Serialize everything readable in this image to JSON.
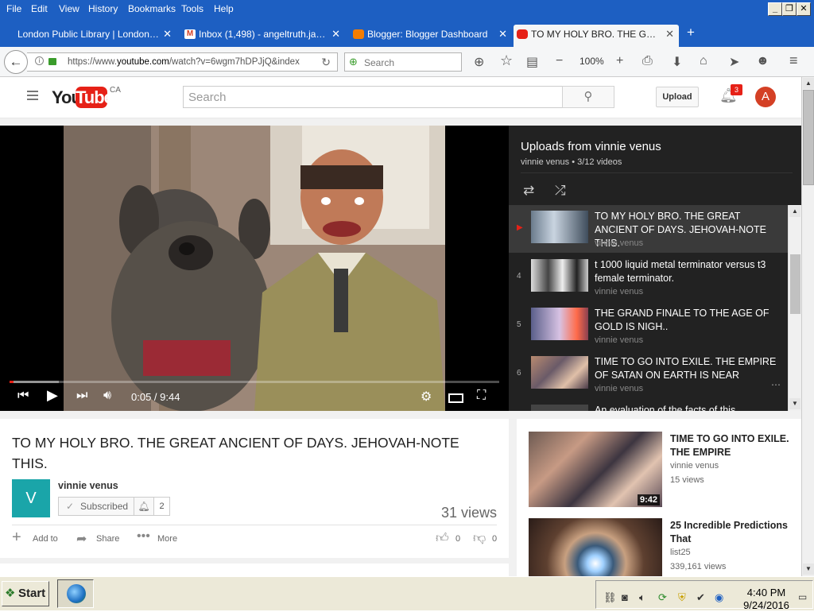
{
  "menubar": {
    "items": [
      "File",
      "Edit",
      "View",
      "History",
      "Bookmarks",
      "Tools",
      "Help"
    ],
    "minimize": "_",
    "restore": "❐",
    "close": "✕"
  },
  "tabs": [
    {
      "title": "London Public Library | London Pu…",
      "close": "✕"
    },
    {
      "title": "Inbox (1,498) - angeltruth.ja…",
      "close": "✕"
    },
    {
      "title": "Blogger: Blogger Dashboard",
      "close": "✕"
    },
    {
      "title": "TO MY HOLY BRO. THE GREAT…",
      "close": "✕"
    }
  ],
  "new_tab": "+",
  "navbar": {
    "url_prefix": "https://www.",
    "url_domain": "youtube.com",
    "url_rest": "/watch?v=6wgm7hDPJjQ&index",
    "search_placeholder": "Search",
    "zoom": "100%",
    "zoom_minus": "−",
    "zoom_plus": "+"
  },
  "youtube": {
    "logo_you": "You",
    "logo_tube": "Tube",
    "logo_region": "CA",
    "search_placeholder": "Search",
    "upload_label": "Upload",
    "notification_count": "3",
    "avatar_letter": "A"
  },
  "player": {
    "time": "0:05 / 9:44",
    "progress_fraction": 0.0086
  },
  "playlist": {
    "title": "Uploads from vinnie venus",
    "subtitle": "vinnie venus • 3/12 videos",
    "current_marker": "▶",
    "items": [
      {
        "index": "",
        "title": "TO MY HOLY BRO. THE GREAT ANCIENT OF DAYS. JEHOVAH-NOTE THIS.",
        "author": "vinnie venus"
      },
      {
        "index": "4",
        "title": "t 1000 liquid metal terminator versus t3 female terminator.",
        "author": "vinnie venus"
      },
      {
        "index": "5",
        "title": "THE GRAND FINALE TO THE AGE OF GOLD IS NIGH..",
        "author": "vinnie venus"
      },
      {
        "index": "6",
        "title": "TIME TO GO INTO EXILE. THE EMPIRE OF SATAN ON EARTH IS NEAR",
        "author": "vinnie venus"
      },
      {
        "index": "",
        "title": "An evaluation of the facts of this",
        "author": ""
      }
    ],
    "more": "⋯"
  },
  "video_info": {
    "title": "TO MY HOLY BRO. THE GREAT ANCIENT OF DAYS. JEHOVAH-NOTE THIS.",
    "channel_initial": "V",
    "channel_name": "vinnie venus",
    "subscribed_label": "Subscribed",
    "subscriber_count": "2",
    "views": "31 views",
    "add_to": "Add to",
    "share": "Share",
    "more": "More",
    "likes": "0",
    "dislikes": "0"
  },
  "related": [
    {
      "title": "TIME TO GO INTO EXILE. THE EMPIRE",
      "author": "vinnie venus",
      "views": "15 views",
      "duration": "9:42"
    },
    {
      "title": "25 Incredible Predictions That",
      "author": "list25",
      "views": "339,161 views",
      "duration": ""
    }
  ],
  "taskbar": {
    "start": "Start",
    "time": "4:40 PM",
    "date": "9/24/2016"
  },
  "colors": {
    "xp_blue": "#1d5fc2",
    "youtube_red": "#e62117",
    "channel_teal": "#1aa5a9",
    "avatar_red": "#d44025"
  }
}
